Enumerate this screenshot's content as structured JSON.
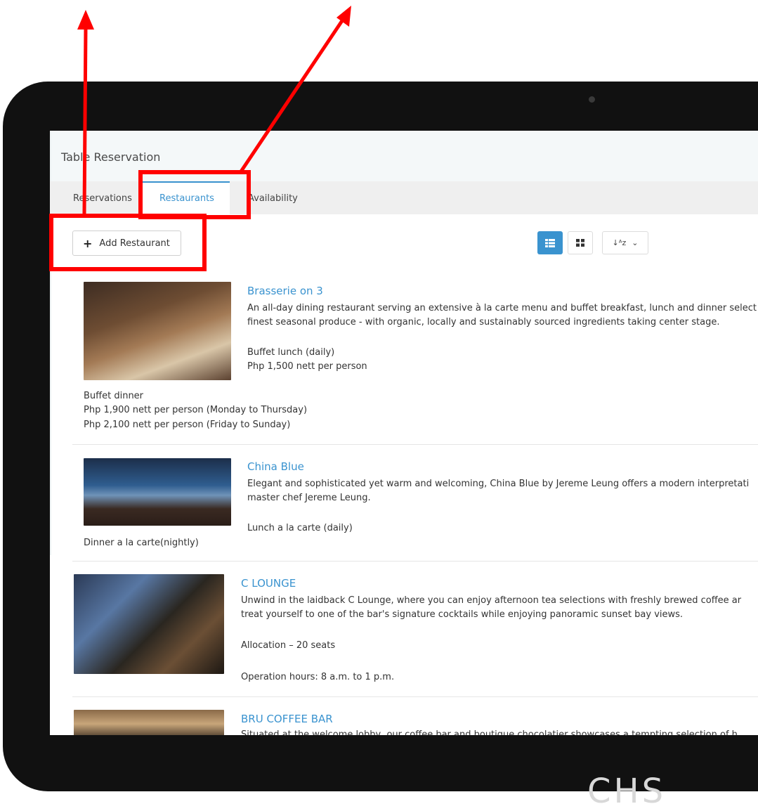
{
  "app": {
    "title": "Table Reservation"
  },
  "tabs": [
    {
      "label": "Reservations"
    },
    {
      "label": "Restaurants",
      "active": true
    },
    {
      "label": "Availability"
    }
  ],
  "toolbar": {
    "add_label": "Add Restaurant",
    "views": [
      "list-view",
      "grid-view",
      "sort-az"
    ]
  },
  "restaurants": [
    {
      "name": "Brasserie on 3",
      "desc1": "An all-day dining restaurant serving an extensive à la carte menu and buffet breakfast, lunch and dinner select",
      "desc2": "finest seasonal produce - with organic, locally and sustainably sourced ingredients taking center stage.",
      "line1": "Buffet lunch (daily)",
      "line2": "Php 1,500 nett per person",
      "extra1": "Buffet dinner",
      "extra2": "Php 1,900 nett per person (Monday to Thursday)",
      "extra3": "Php 2,100 nett per person (Friday to Sunday)"
    },
    {
      "name": "China Blue",
      "desc1": "Elegant and sophisticated yet warm and welcoming, China Blue by Jereme Leung offers a modern interpretati",
      "desc2": "master chef Jereme Leung.",
      "line1": "Lunch a la carte (daily)",
      "extra1": "Dinner a la carte(nightly)"
    },
    {
      "name": "C LOUNGE",
      "desc1": "Unwind in the laidback C Lounge, where you can enjoy afternoon tea selections with freshly brewed coffee ar",
      "desc2": "treat yourself to one of the bar's signature cocktails while enjoying panoramic sunset bay views.",
      "line1": "Allocation – 20 seats",
      "line2": "Operation hours: 8 a.m. to 1 p.m."
    },
    {
      "name": "BRU COFFEE BAR",
      "desc1": "Situated at the welcome lobby, our coffee bar and boutique chocolatier showcases a tempting selection of h"
    }
  ],
  "colors": {
    "accent": "#3a93cf",
    "annotation": "#ff0000",
    "bezel": "#111111"
  }
}
